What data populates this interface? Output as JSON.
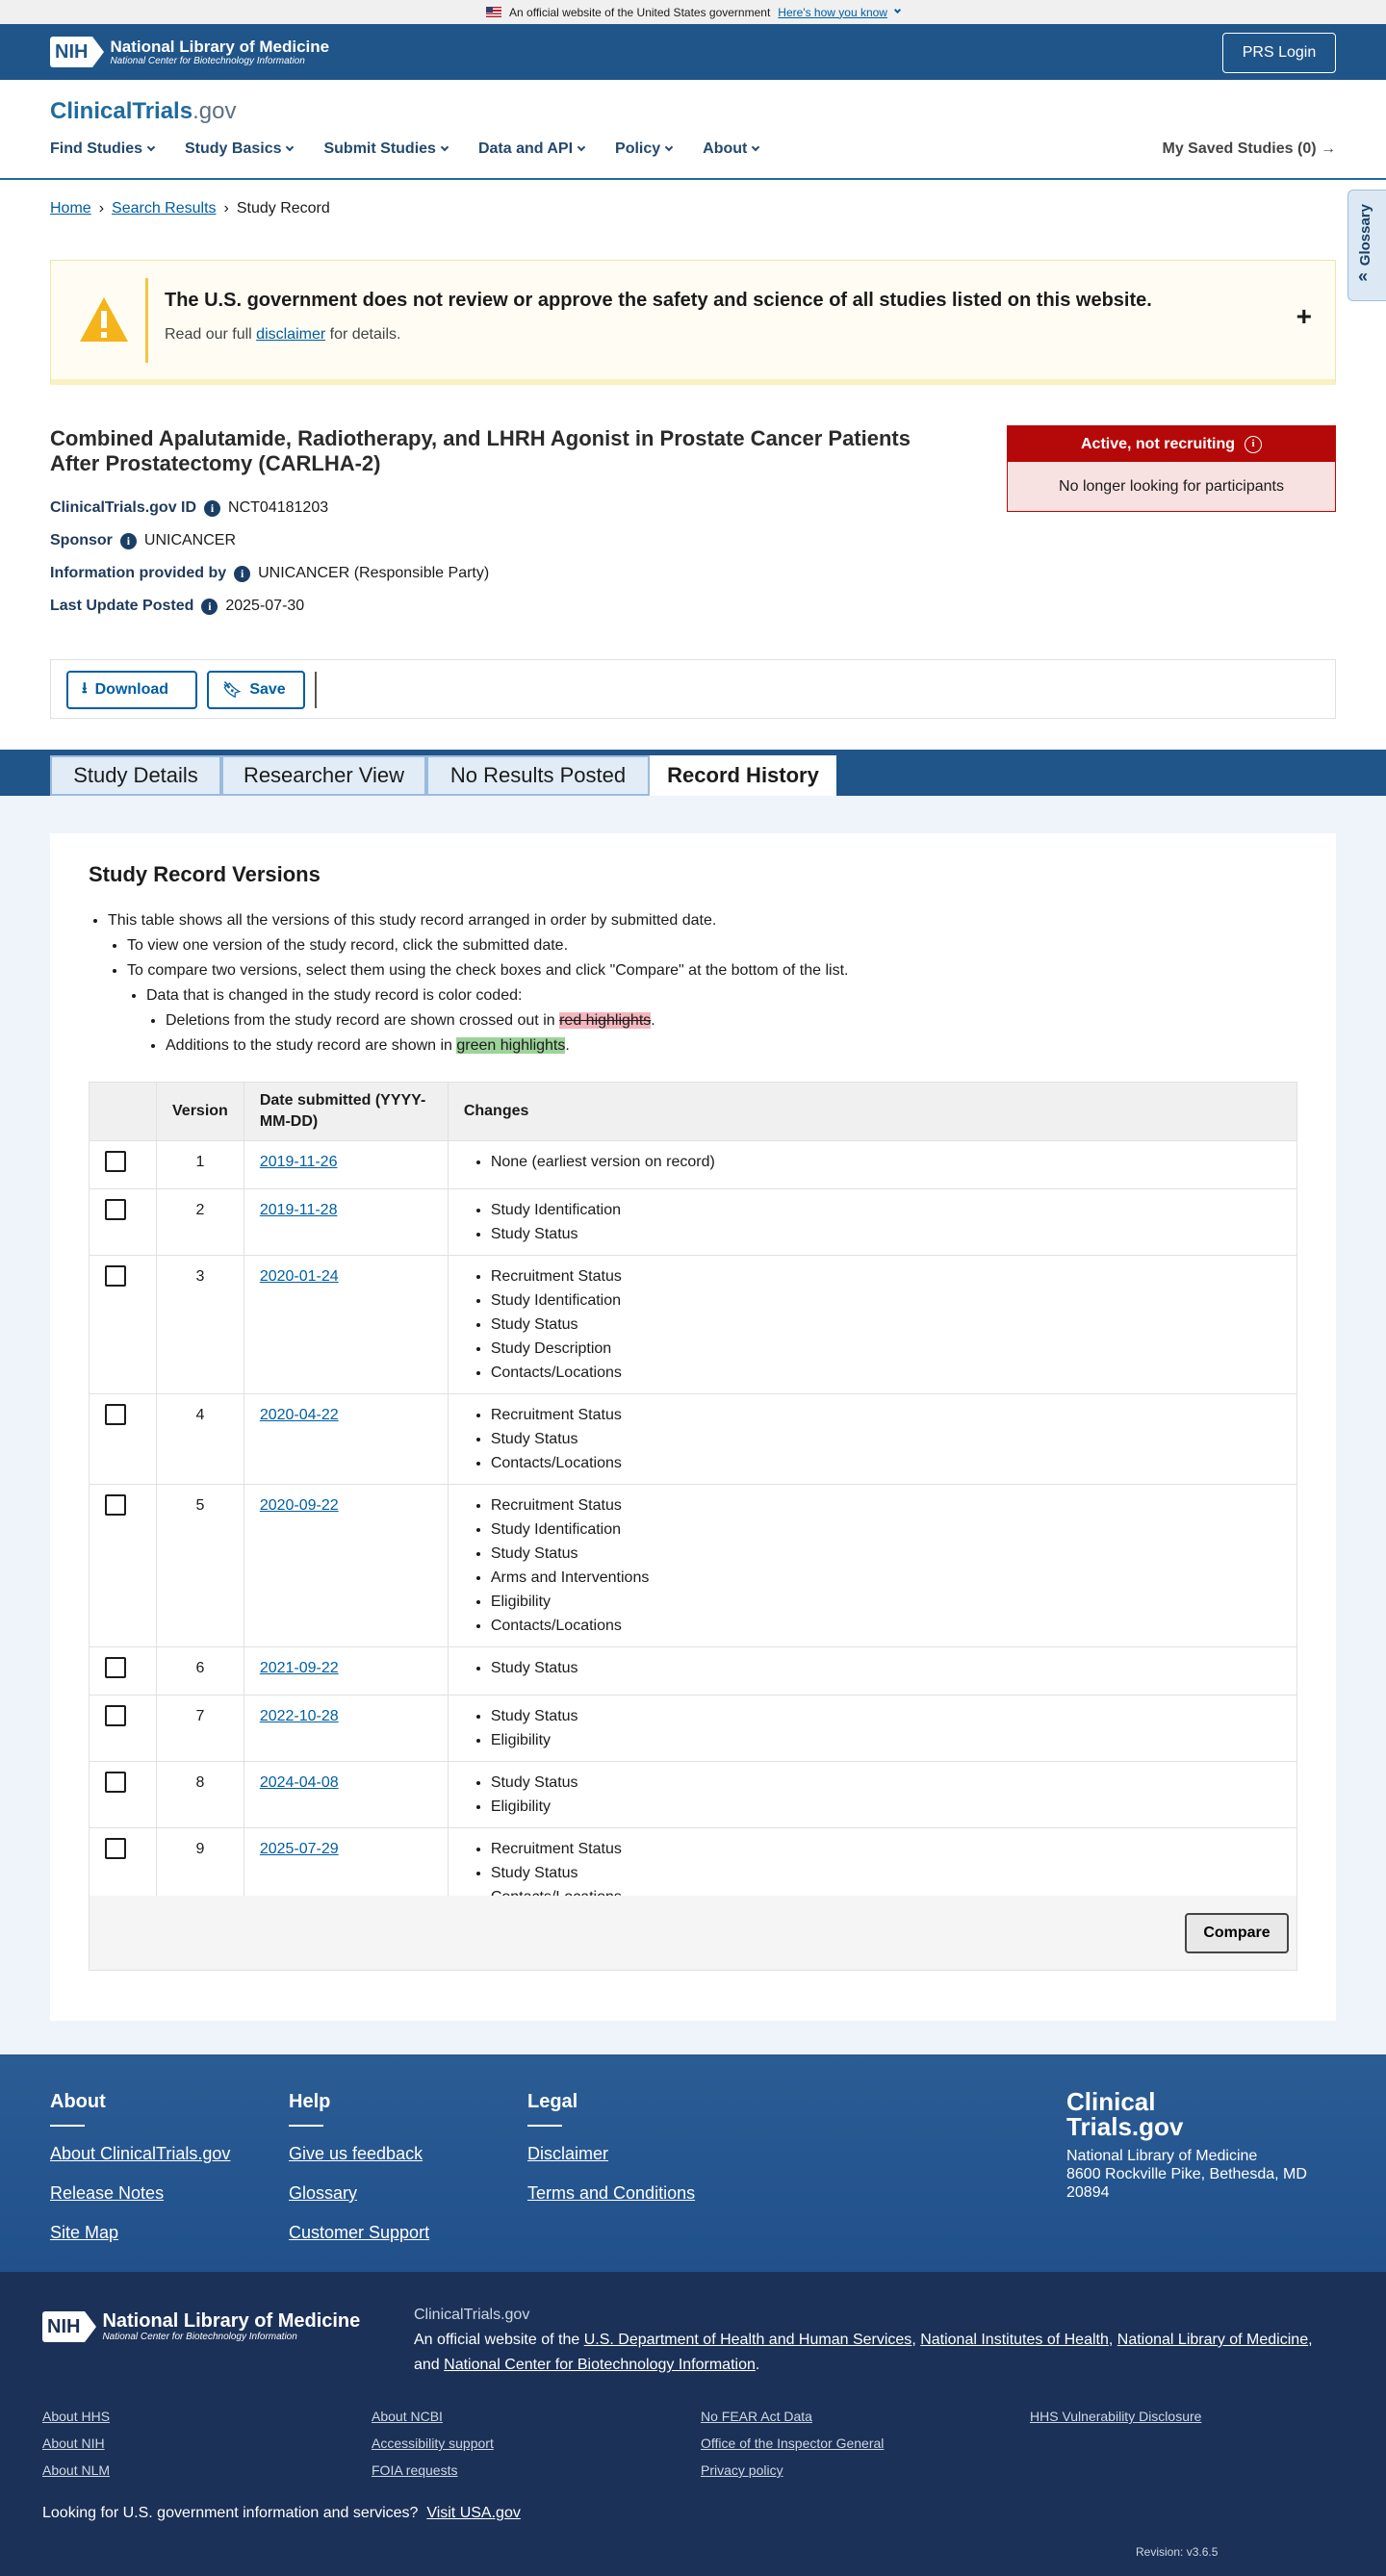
{
  "gov_banner": {
    "text": "An official website of the United States government",
    "link": "Here's how you know"
  },
  "nih": {
    "abbr": "NIH",
    "name": "National Library of Medicine",
    "sub": "National Center for Biotechnology Information",
    "login": "PRS Login"
  },
  "site": {
    "brand_main": "ClinicalTrials",
    "brand_tld": ".gov"
  },
  "nav": {
    "items": [
      "Find Studies",
      "Study Basics",
      "Submit Studies",
      "Data and API",
      "Policy",
      "About"
    ],
    "saved": "My Saved Studies (0)"
  },
  "breadcrumb": {
    "home": "Home",
    "search": "Search Results",
    "current": "Study Record"
  },
  "glossary": {
    "label": "Glossary"
  },
  "disclaimer": {
    "title": "The U.S. government does not review or approve the safety and science of all studies listed on this website.",
    "pre": "Read our full ",
    "link": "disclaimer",
    "post": " for details."
  },
  "study": {
    "title": "Combined Apalutamide, Radiotherapy, and LHRH Agonist in Prostate Cancer Patients After Prostatectomy (CARLHA-2)",
    "id_label": "ClinicalTrials.gov ID",
    "id": "NCT04181203",
    "sponsor_label": "Sponsor",
    "sponsor": "UNICANCER",
    "info_label": "Information provided by",
    "info": "UNICANCER (Responsible Party)",
    "update_label": "Last Update Posted",
    "update": "2025-07-30"
  },
  "status": {
    "label": "Active, not recruiting",
    "desc": "No longer looking for participants",
    "color": "#b50909"
  },
  "toolbar": {
    "download": "Download",
    "save": "Save"
  },
  "tabs": [
    "Study Details",
    "Researcher View",
    "No Results Posted",
    "Record History"
  ],
  "versions": {
    "heading": "Study Record Versions",
    "b1": "This table shows all the versions of this study record arranged in order by submitted date.",
    "b2": "To view one version of the study record, click the submitted date.",
    "b3": "To compare two versions, select them using the check boxes and click \"Compare\" at the bottom of the list.",
    "b4": "Data that is changed in the study record is color coded:",
    "b5_pre": "Deletions from the study record are shown crossed out in ",
    "b5_mark": "red highlights",
    "b5_post": ".",
    "b6_pre": "Additions to the study record are shown in ",
    "b6_mark": "green highlights",
    "b6_post": ".",
    "col_version": "Version",
    "col_date": "Date submitted (YYYY-MM-DD)",
    "col_changes": "Changes",
    "rows": [
      {
        "v": "1",
        "date": "2019-11-26",
        "changes": [
          "None (earliest version on record)"
        ]
      },
      {
        "v": "2",
        "date": "2019-11-28",
        "changes": [
          "Study Identification",
          "Study Status"
        ]
      },
      {
        "v": "3",
        "date": "2020-01-24",
        "changes": [
          "Recruitment Status",
          "Study Identification",
          "Study Status",
          "Study Description",
          "Contacts/Locations"
        ]
      },
      {
        "v": "4",
        "date": "2020-04-22",
        "changes": [
          "Recruitment Status",
          "Study Status",
          "Contacts/Locations"
        ]
      },
      {
        "v": "5",
        "date": "2020-09-22",
        "changes": [
          "Recruitment Status",
          "Study Identification",
          "Study Status",
          "Arms and Interventions",
          "Eligibility",
          "Contacts/Locations"
        ]
      },
      {
        "v": "6",
        "date": "2021-09-22",
        "changes": [
          "Study Status"
        ]
      },
      {
        "v": "7",
        "date": "2022-10-28",
        "changes": [
          "Study Status",
          "Eligibility"
        ]
      },
      {
        "v": "8",
        "date": "2024-04-08",
        "changes": [
          "Study Status",
          "Eligibility"
        ]
      },
      {
        "v": "9",
        "date": "2025-07-29",
        "changes": [
          "Recruitment Status",
          "Study Status",
          "Contacts/Locations"
        ]
      }
    ],
    "compare": "Compare"
  },
  "footer": {
    "about": {
      "title": "About",
      "links": [
        "About ClinicalTrials.gov",
        "Release Notes",
        "Site Map"
      ]
    },
    "help": {
      "title": "Help",
      "links": [
        "Give us feedback",
        "Glossary",
        "Customer Support"
      ]
    },
    "legal": {
      "title": "Legal",
      "links": [
        "Disclaimer",
        "Terms and Conditions"
      ]
    },
    "logo1": "Clinical",
    "logo2": "Trials.gov",
    "addr1": "National Library of Medicine",
    "addr2": "8600 Rockville Pike, Bethesda, MD 20894"
  },
  "footer_bottom": {
    "site": "ClinicalTrials.gov",
    "off_pre": "An official website of the ",
    "hhs": "U.S. Department of Health and Human Services",
    "nih": "National Institutes of Health",
    "nlm": "National Library of Medicine",
    "and": ", and ",
    "ncbi": "National Center for Biotechnology Information",
    "col1": [
      "About HHS",
      "About NIH",
      "About NLM"
    ],
    "col2": [
      "About NCBI",
      "Accessibility support",
      "FOIA requests"
    ],
    "col3": [
      "No FEAR Act Data",
      "Office of the Inspector General",
      "Privacy policy"
    ],
    "col4": [
      "HHS Vulnerability Disclosure"
    ],
    "usa_pre": "Looking for U.S. government information and services?",
    "usa_link": "Visit USA.gov",
    "revision": "Revision: v3.6.5"
  }
}
